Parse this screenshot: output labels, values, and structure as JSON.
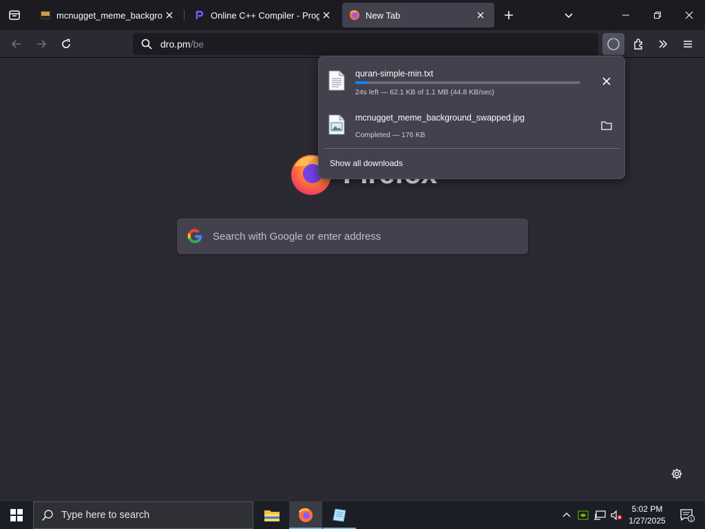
{
  "tabs": [
    {
      "title": "mcnugget_meme_background_",
      "favicon": "image-file-icon",
      "active": false
    },
    {
      "title": "Online C++ Compiler - Program",
      "favicon": "programiz-icon",
      "active": false
    },
    {
      "title": "New Tab",
      "favicon": "firefox-icon",
      "active": true
    }
  ],
  "urlbar": {
    "host": "dro.pm",
    "path": "/be"
  },
  "newtab": {
    "brand": "Firefox",
    "search_placeholder": "Search with Google or enter address"
  },
  "downloads": {
    "items": [
      {
        "name": "quran-simple-min.txt",
        "status": "24s left — 62.1 KB of 1.1 MB (44.8 KB/sec)",
        "progress": 0.054,
        "action": "cancel-icon"
      },
      {
        "name": "mcnugget_meme_background_swapped.jpg",
        "status": "Completed — 176 KB",
        "action": "folder-icon"
      }
    ],
    "show_all": "Show all downloads"
  },
  "taskbar": {
    "search_placeholder": "Type here to search",
    "time": "5:02 PM",
    "date": "1/27/2025",
    "notification_count": "1"
  },
  "colors": {
    "accent": "#0a84ff",
    "tab_active": "#42414d",
    "tabstrip": "#1c1b22",
    "content": "#2b2a33"
  }
}
